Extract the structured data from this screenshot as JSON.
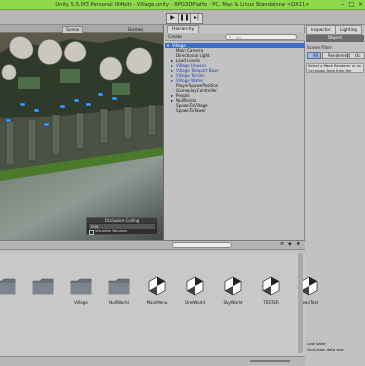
{
  "window": {
    "title": "Unity 5.5.0f3 Personal (64bit) - Village.unity - RPG3DPlatfo - PC, Mac & Linux Standalone <DX11>"
  },
  "toolbar": {
    "play_icon": "play-icon",
    "pause_icon": "pause-icon",
    "step_icon": "step-icon"
  },
  "scene": {
    "tab_label": "Scene",
    "menu_label": "Gizmos",
    "occlusion_title": "Occlusion Culling",
    "occlusion_row1": "Edit",
    "occlusion_row2": "Visualize Volumes"
  },
  "hierarchy": {
    "tab_label": "Hierarchy",
    "create_label": "Create",
    "search_placeholder": "All",
    "items": [
      {
        "label": "Village",
        "kind": "root"
      },
      {
        "label": "Main Camera",
        "kind": "plain"
      },
      {
        "label": "Directional Light",
        "kind": "plain"
      },
      {
        "label": "Load Levels",
        "kind": "parent"
      },
      {
        "label": "Village Houses",
        "kind": "prefab"
      },
      {
        "label": "Village Teleport Base",
        "kind": "prefab"
      },
      {
        "label": "Village Terrain",
        "kind": "prefab"
      },
      {
        "label": "Village Water",
        "kind": "prefab"
      },
      {
        "label": "PlayerSpawnPosition",
        "kind": "plain"
      },
      {
        "label": "GameplayController",
        "kind": "plain"
      },
      {
        "label": "People",
        "kind": "parent"
      },
      {
        "label": "NullPoints",
        "kind": "parent"
      },
      {
        "label": "SpawnToVillage",
        "kind": "plain"
      },
      {
        "label": "SpawnToTower",
        "kind": "plain"
      }
    ]
  },
  "inspector": {
    "tab_inspector": "Inspector",
    "tab_lighting": "Lighting",
    "object_label": "Object",
    "scene_filter_label": "Scene Filter:",
    "filter_all": "All",
    "filter_renderers": "Renderers",
    "filter_occluders": "Oc",
    "hint": "Select a Mesh Renderer or an Occlusion Area from the scene.",
    "status_last_bake": "Last bake:",
    "status_no_data": "Occlusion data size"
  },
  "project": {
    "assets": [
      {
        "label": "",
        "kind": "folder"
      },
      {
        "label": "",
        "kind": "folder"
      },
      {
        "label": "Village",
        "kind": "folder"
      },
      {
        "label": "NullWorld",
        "kind": "folder"
      },
      {
        "label": "MainMenu",
        "kind": "unity"
      },
      {
        "label": "OneWorld",
        "kind": "unity"
      },
      {
        "label": "SkyWorld",
        "kind": "unity"
      },
      {
        "label": "TESTER",
        "kind": "unity"
      },
      {
        "label": "TownTest",
        "kind": "unity"
      }
    ]
  },
  "colors": {
    "titlebar": "#8fd94c",
    "selection": "#3d6fc8",
    "prefab_text": "#1a3dbf",
    "panel_bg": "#c2c2c2"
  }
}
